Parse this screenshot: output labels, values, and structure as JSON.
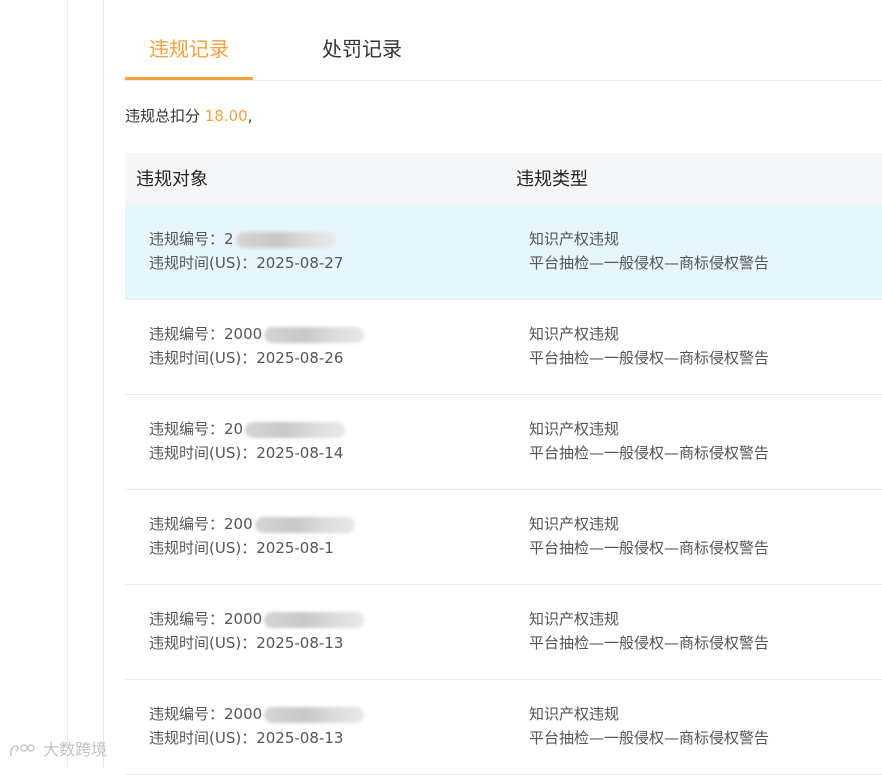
{
  "tabs": [
    {
      "label": "违规记录",
      "active": true
    },
    {
      "label": "处罚记录",
      "active": false
    }
  ],
  "summary": {
    "prefix": "违规总扣分 ",
    "score": "18.00",
    "suffix": ","
  },
  "table": {
    "columns": [
      "违规对象",
      "违规类型"
    ],
    "rows": [
      {
        "id_label": "违规编号：",
        "id_visible": "2",
        "time_label": "违规时间(US)：",
        "time": "2025-08-27",
        "category": "知识产权违规",
        "detail": "平台抽检—一般侵权—商标侵权警告",
        "highlighted": true
      },
      {
        "id_label": "违规编号：",
        "id_visible": "2000",
        "time_label": "违规时间(US)：",
        "time": "2025-08-26",
        "category": "知识产权违规",
        "detail": "平台抽检—一般侵权—商标侵权警告",
        "highlighted": false
      },
      {
        "id_label": "违规编号：",
        "id_visible": "20",
        "time_label": "违规时间(US)：",
        "time": "2025-08-14",
        "category": "知识产权违规",
        "detail": "平台抽检—一般侵权—商标侵权警告",
        "highlighted": false
      },
      {
        "id_label": "违规编号：",
        "id_visible": "200",
        "time_label": "违规时间(US)：",
        "time": "2025-08-1",
        "category": "知识产权违规",
        "detail": "平台抽检—一般侵权—商标侵权警告",
        "highlighted": false
      },
      {
        "id_label": "违规编号：",
        "id_visible": "2000",
        "time_label": "违规时间(US)：",
        "time": "2025-08-13",
        "category": "知识产权违规",
        "detail": "平台抽检—一般侵权—商标侵权警告",
        "highlighted": false
      },
      {
        "id_label": "违规编号：",
        "id_visible": "2000",
        "time_label": "违规时间(US)：",
        "time": "2025-08-13",
        "category": "知识产权违规",
        "detail": "平台抽检—一般侵权—商标侵权警告",
        "highlighted": false
      }
    ]
  },
  "watermark": {
    "text": "大数跨境"
  },
  "colors": {
    "accent": "#f7a03a",
    "highlight_row": "#e6f6fd",
    "header_bg": "#f5f6f7"
  }
}
